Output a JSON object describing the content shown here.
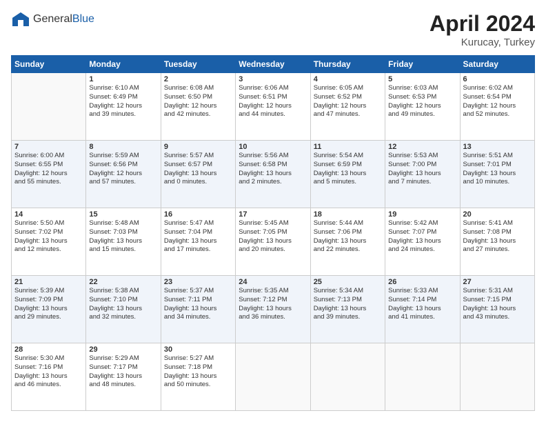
{
  "header": {
    "logo_general": "General",
    "logo_blue": "Blue",
    "month_title": "April 2024",
    "location": "Kurucay, Turkey"
  },
  "weekdays": [
    "Sunday",
    "Monday",
    "Tuesday",
    "Wednesday",
    "Thursday",
    "Friday",
    "Saturday"
  ],
  "weeks": [
    [
      {
        "num": "",
        "info": ""
      },
      {
        "num": "1",
        "info": "Sunrise: 6:10 AM\nSunset: 6:49 PM\nDaylight: 12 hours\nand 39 minutes."
      },
      {
        "num": "2",
        "info": "Sunrise: 6:08 AM\nSunset: 6:50 PM\nDaylight: 12 hours\nand 42 minutes."
      },
      {
        "num": "3",
        "info": "Sunrise: 6:06 AM\nSunset: 6:51 PM\nDaylight: 12 hours\nand 44 minutes."
      },
      {
        "num": "4",
        "info": "Sunrise: 6:05 AM\nSunset: 6:52 PM\nDaylight: 12 hours\nand 47 minutes."
      },
      {
        "num": "5",
        "info": "Sunrise: 6:03 AM\nSunset: 6:53 PM\nDaylight: 12 hours\nand 49 minutes."
      },
      {
        "num": "6",
        "info": "Sunrise: 6:02 AM\nSunset: 6:54 PM\nDaylight: 12 hours\nand 52 minutes."
      }
    ],
    [
      {
        "num": "7",
        "info": "Sunrise: 6:00 AM\nSunset: 6:55 PM\nDaylight: 12 hours\nand 55 minutes."
      },
      {
        "num": "8",
        "info": "Sunrise: 5:59 AM\nSunset: 6:56 PM\nDaylight: 12 hours\nand 57 minutes."
      },
      {
        "num": "9",
        "info": "Sunrise: 5:57 AM\nSunset: 6:57 PM\nDaylight: 13 hours\nand 0 minutes."
      },
      {
        "num": "10",
        "info": "Sunrise: 5:56 AM\nSunset: 6:58 PM\nDaylight: 13 hours\nand 2 minutes."
      },
      {
        "num": "11",
        "info": "Sunrise: 5:54 AM\nSunset: 6:59 PM\nDaylight: 13 hours\nand 5 minutes."
      },
      {
        "num": "12",
        "info": "Sunrise: 5:53 AM\nSunset: 7:00 PM\nDaylight: 13 hours\nand 7 minutes."
      },
      {
        "num": "13",
        "info": "Sunrise: 5:51 AM\nSunset: 7:01 PM\nDaylight: 13 hours\nand 10 minutes."
      }
    ],
    [
      {
        "num": "14",
        "info": "Sunrise: 5:50 AM\nSunset: 7:02 PM\nDaylight: 13 hours\nand 12 minutes."
      },
      {
        "num": "15",
        "info": "Sunrise: 5:48 AM\nSunset: 7:03 PM\nDaylight: 13 hours\nand 15 minutes."
      },
      {
        "num": "16",
        "info": "Sunrise: 5:47 AM\nSunset: 7:04 PM\nDaylight: 13 hours\nand 17 minutes."
      },
      {
        "num": "17",
        "info": "Sunrise: 5:45 AM\nSunset: 7:05 PM\nDaylight: 13 hours\nand 20 minutes."
      },
      {
        "num": "18",
        "info": "Sunrise: 5:44 AM\nSunset: 7:06 PM\nDaylight: 13 hours\nand 22 minutes."
      },
      {
        "num": "19",
        "info": "Sunrise: 5:42 AM\nSunset: 7:07 PM\nDaylight: 13 hours\nand 24 minutes."
      },
      {
        "num": "20",
        "info": "Sunrise: 5:41 AM\nSunset: 7:08 PM\nDaylight: 13 hours\nand 27 minutes."
      }
    ],
    [
      {
        "num": "21",
        "info": "Sunrise: 5:39 AM\nSunset: 7:09 PM\nDaylight: 13 hours\nand 29 minutes."
      },
      {
        "num": "22",
        "info": "Sunrise: 5:38 AM\nSunset: 7:10 PM\nDaylight: 13 hours\nand 32 minutes."
      },
      {
        "num": "23",
        "info": "Sunrise: 5:37 AM\nSunset: 7:11 PM\nDaylight: 13 hours\nand 34 minutes."
      },
      {
        "num": "24",
        "info": "Sunrise: 5:35 AM\nSunset: 7:12 PM\nDaylight: 13 hours\nand 36 minutes."
      },
      {
        "num": "25",
        "info": "Sunrise: 5:34 AM\nSunset: 7:13 PM\nDaylight: 13 hours\nand 39 minutes."
      },
      {
        "num": "26",
        "info": "Sunrise: 5:33 AM\nSunset: 7:14 PM\nDaylight: 13 hours\nand 41 minutes."
      },
      {
        "num": "27",
        "info": "Sunrise: 5:31 AM\nSunset: 7:15 PM\nDaylight: 13 hours\nand 43 minutes."
      }
    ],
    [
      {
        "num": "28",
        "info": "Sunrise: 5:30 AM\nSunset: 7:16 PM\nDaylight: 13 hours\nand 46 minutes."
      },
      {
        "num": "29",
        "info": "Sunrise: 5:29 AM\nSunset: 7:17 PM\nDaylight: 13 hours\nand 48 minutes."
      },
      {
        "num": "30",
        "info": "Sunrise: 5:27 AM\nSunset: 7:18 PM\nDaylight: 13 hours\nand 50 minutes."
      },
      {
        "num": "",
        "info": ""
      },
      {
        "num": "",
        "info": ""
      },
      {
        "num": "",
        "info": ""
      },
      {
        "num": "",
        "info": ""
      }
    ]
  ]
}
